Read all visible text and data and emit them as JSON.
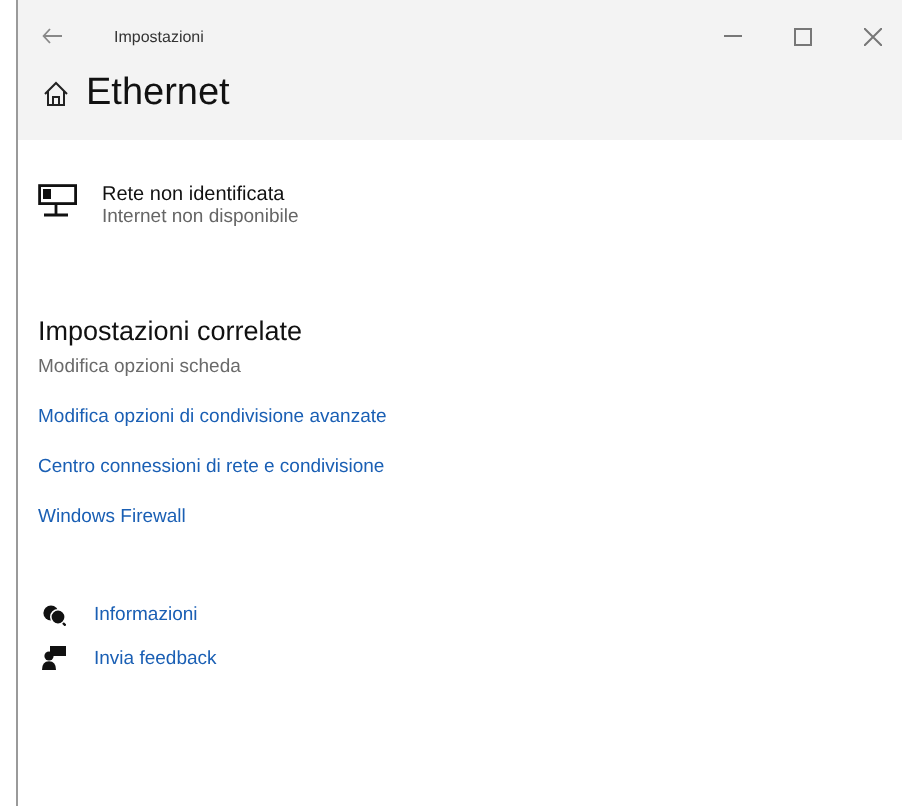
{
  "window": {
    "title": "Impostazioni"
  },
  "page": {
    "title": "Ethernet"
  },
  "network": {
    "name": "Rete non identificata",
    "status": "Internet non disponibile"
  },
  "related": {
    "heading": "Impostazioni correlate",
    "links": [
      {
        "label": "Modifica opzioni scheda",
        "disabled": true
      },
      {
        "label": "Modifica opzioni di condivisione avanzate",
        "disabled": false
      },
      {
        "label": "Centro connessioni di rete e condivisione",
        "disabled": false
      },
      {
        "label": "Windows Firewall",
        "disabled": false
      }
    ]
  },
  "help": [
    {
      "kind": "info",
      "label": "Informazioni"
    },
    {
      "kind": "feedback",
      "label": "Invia feedback"
    }
  ]
}
